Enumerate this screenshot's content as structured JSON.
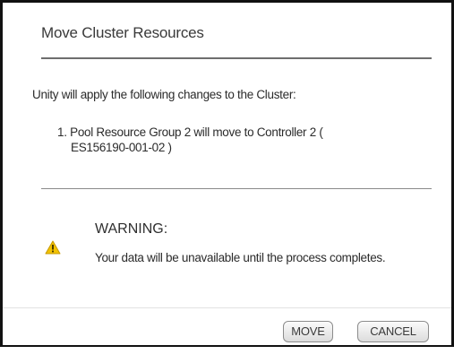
{
  "dialog": {
    "title": "Move Cluster Resources",
    "intro": "Unity will apply the following changes to the Cluster:",
    "changes": [
      {
        "number": "1.",
        "line1": "Pool Resource Group 2 will move to Controller 2 (",
        "line2": "ES156190-001-02 )"
      }
    ],
    "warning": {
      "icon": "warning-triangle-icon",
      "title": "WARNING:",
      "text": "Your data will be unavailable until the process completes."
    },
    "buttons": {
      "move_label": "MOVE",
      "cancel_label": "CANCEL"
    }
  },
  "colors": {
    "warning_icon": "#f2c200",
    "title_rule": "#6e6e6e",
    "frame_border": "#111111"
  }
}
